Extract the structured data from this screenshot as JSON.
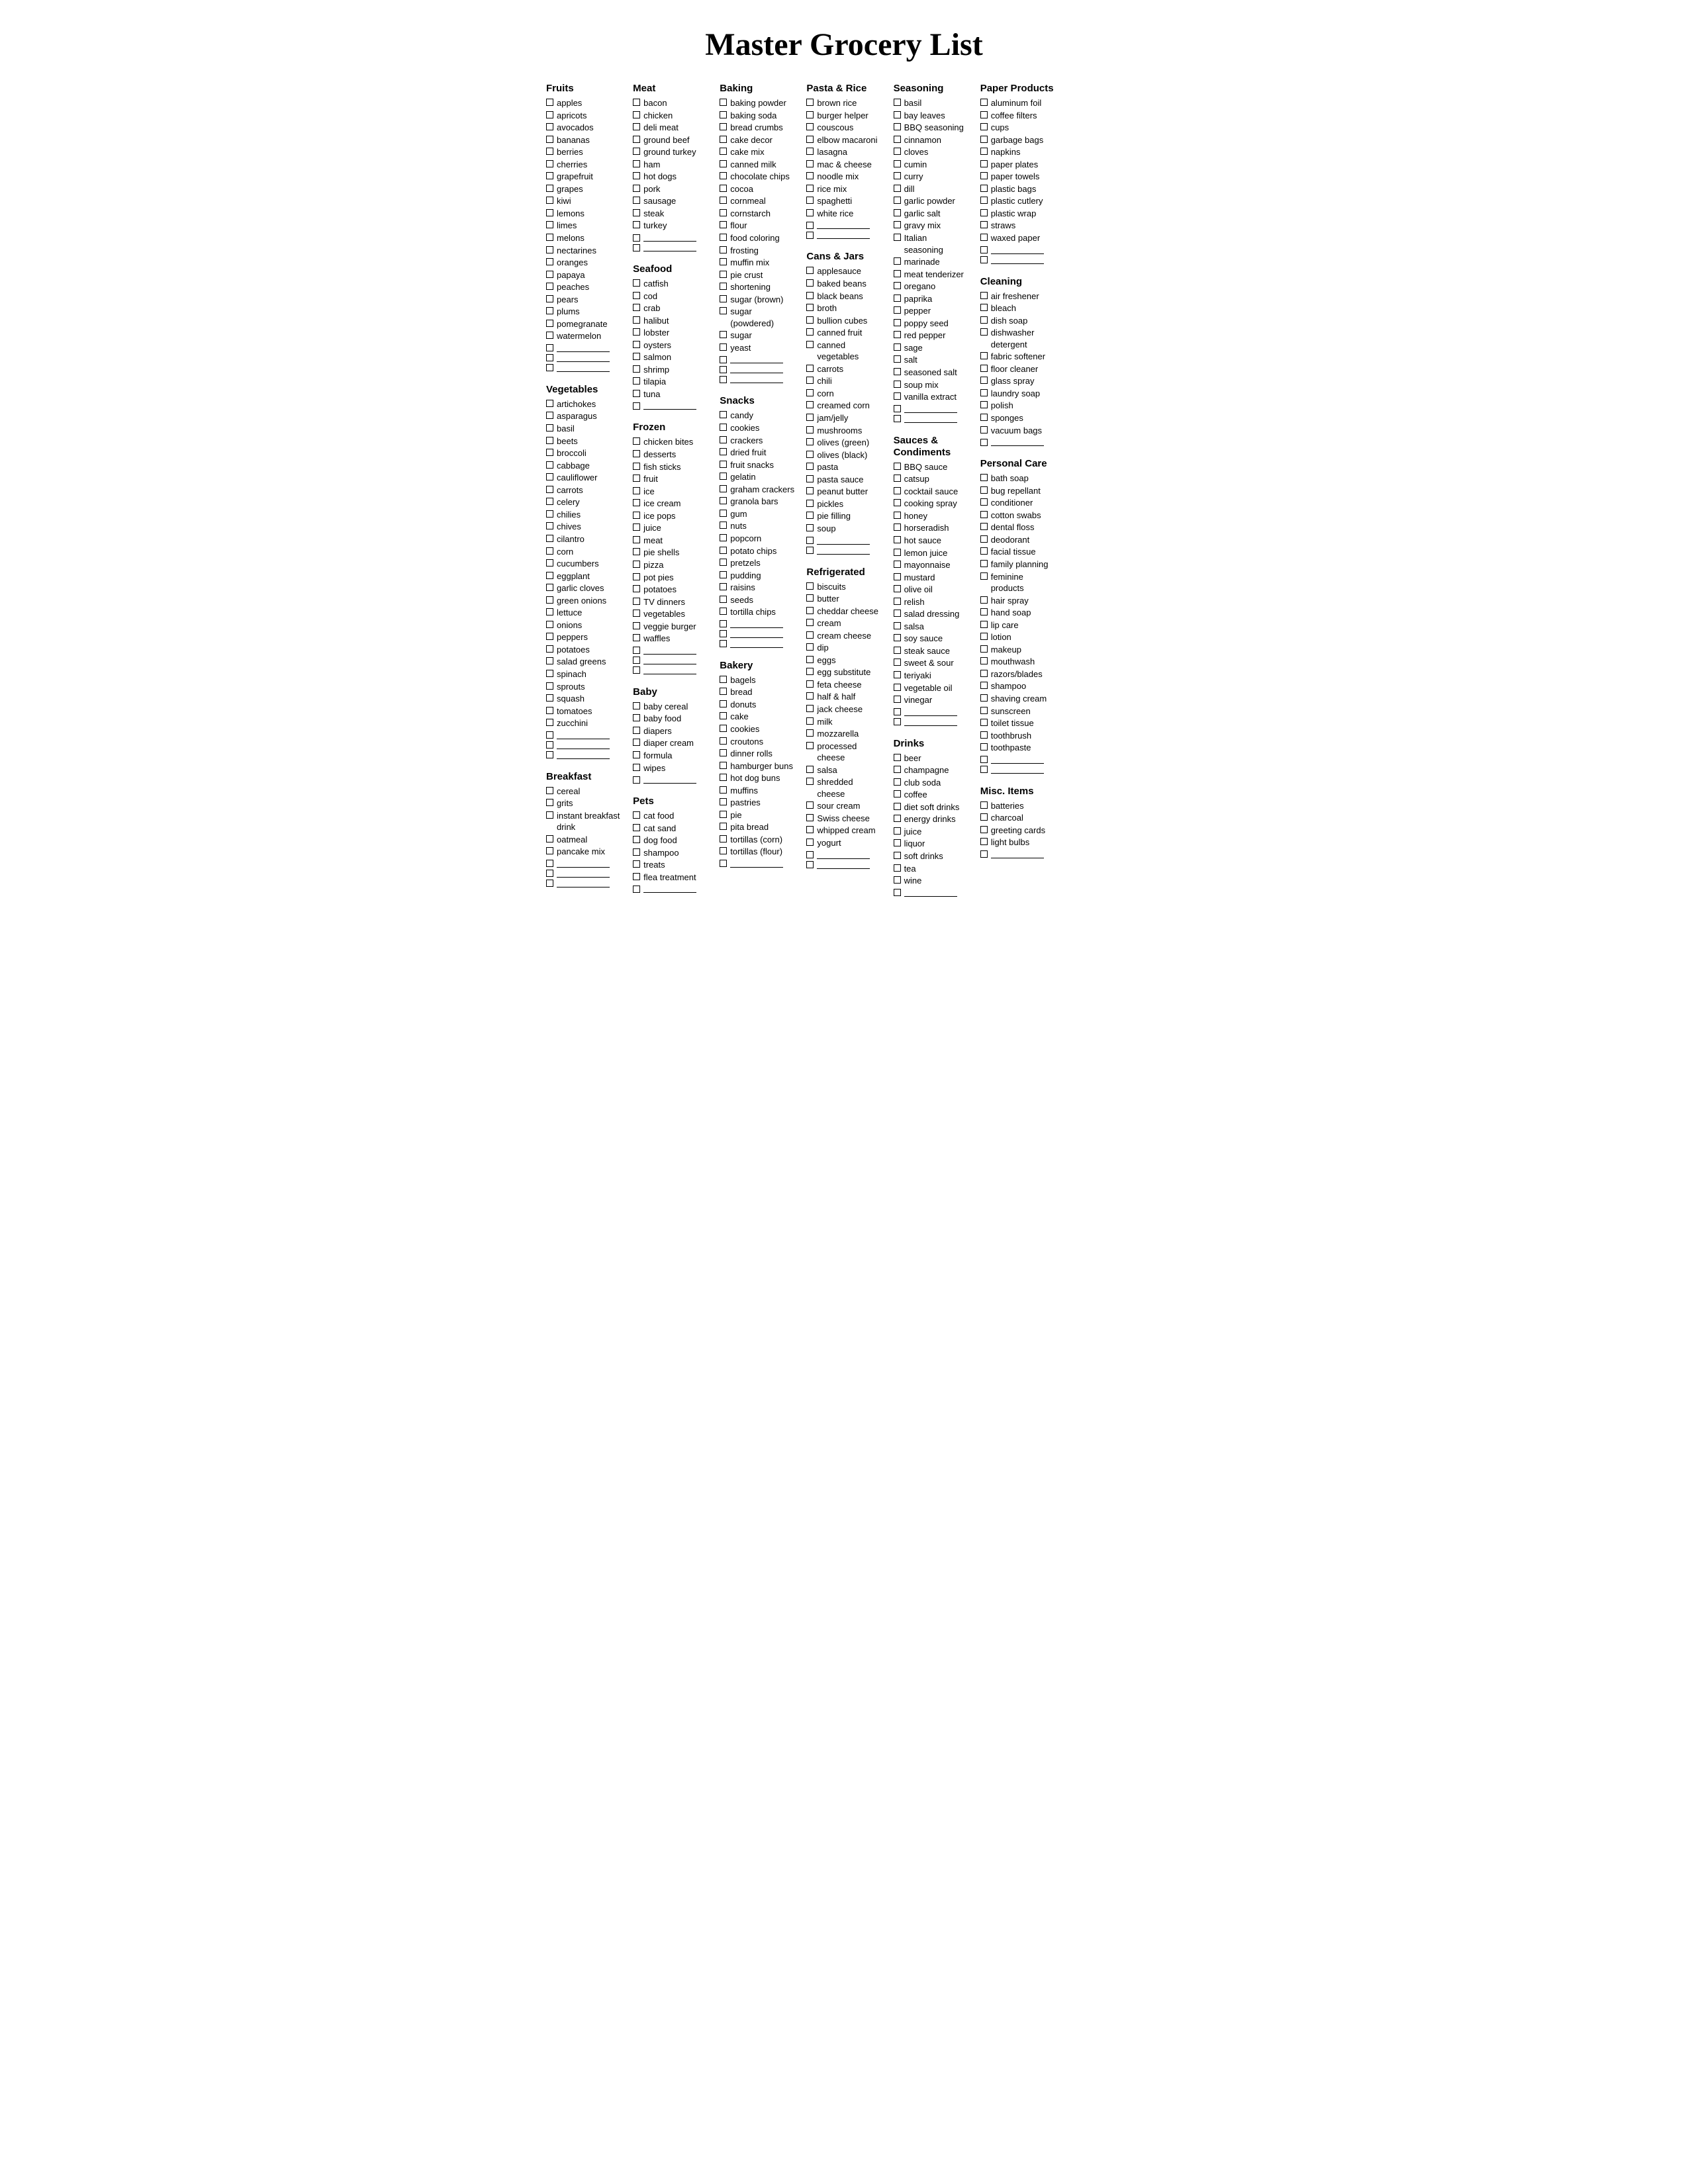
{
  "title": "Master Grocery List",
  "columns": [
    {
      "sections": [
        {
          "title": "Fruits",
          "items": [
            "apples",
            "apricots",
            "avocados",
            "bananas",
            "berries",
            "cherries",
            "grapefruit",
            "grapes",
            "kiwi",
            "lemons",
            "limes",
            "melons",
            "nectarines",
            "oranges",
            "papaya",
            "peaches",
            "pears",
            "plums",
            "pomegranate",
            "watermelon"
          ],
          "blanks": 3
        },
        {
          "title": "Vegetables",
          "items": [
            "artichokes",
            "asparagus",
            "basil",
            "beets",
            "broccoli",
            "cabbage",
            "cauliflower",
            "carrots",
            "celery",
            "chilies",
            "chives",
            "cilantro",
            "corn",
            "cucumbers",
            "eggplant",
            "garlic cloves",
            "green onions",
            "lettuce",
            "onions",
            "peppers",
            "potatoes",
            "salad greens",
            "spinach",
            "sprouts",
            "squash",
            "tomatoes",
            "zucchini"
          ],
          "blanks": 3
        },
        {
          "title": "Breakfast",
          "items": [
            "cereal",
            "grits",
            "instant breakfast drink",
            "oatmeal",
            "pancake mix"
          ],
          "blanks": 3
        }
      ]
    },
    {
      "sections": [
        {
          "title": "Meat",
          "items": [
            "bacon",
            "chicken",
            "deli meat",
            "ground beef",
            "ground turkey",
            "ham",
            "hot dogs",
            "pork",
            "sausage",
            "steak",
            "turkey"
          ],
          "blanks": 2
        },
        {
          "title": "Seafood",
          "items": [
            "catfish",
            "cod",
            "crab",
            "halibut",
            "lobster",
            "oysters",
            "salmon",
            "shrimp",
            "tilapia",
            "tuna"
          ],
          "blanks": 1
        },
        {
          "title": "Frozen",
          "items": [
            "chicken bites",
            "desserts",
            "fish sticks",
            "fruit",
            "ice",
            "ice cream",
            "ice pops",
            "juice",
            "meat",
            "pie shells",
            "pizza",
            "pot pies",
            "potatoes",
            "TV dinners",
            "vegetables",
            "veggie burger",
            "waffles"
          ],
          "blanks": 3
        },
        {
          "title": "Baby",
          "items": [
            "baby cereal",
            "baby food",
            "diapers",
            "diaper cream",
            "formula",
            "wipes"
          ],
          "blanks": 1
        },
        {
          "title": "Pets",
          "items": [
            "cat food",
            "cat sand",
            "dog food",
            "shampoo",
            "treats",
            "flea treatment"
          ],
          "blanks": 1
        }
      ]
    },
    {
      "sections": [
        {
          "title": "Baking",
          "items": [
            "baking powder",
            "baking soda",
            "bread crumbs",
            "cake decor",
            "cake mix",
            "canned milk",
            "chocolate chips",
            "cocoa",
            "cornmeal",
            "cornstarch",
            "flour",
            "food coloring",
            "frosting",
            "muffin mix",
            "pie crust",
            "shortening",
            "sugar (brown)",
            "sugar (powdered)",
            "sugar",
            "yeast"
          ],
          "blanks": 3
        },
        {
          "title": "Snacks",
          "items": [
            "candy",
            "cookies",
            "crackers",
            "dried fruit",
            "fruit snacks",
            "gelatin",
            "graham crackers",
            "granola bars",
            "gum",
            "nuts",
            "popcorn",
            "potato chips",
            "pretzels",
            "pudding",
            "raisins",
            "seeds",
            "tortilla chips"
          ],
          "blanks": 3
        },
        {
          "title": "Bakery",
          "items": [
            "bagels",
            "bread",
            "donuts",
            "cake",
            "cookies",
            "croutons",
            "dinner rolls",
            "hamburger buns",
            "hot dog buns",
            "muffins",
            "pastries",
            "pie",
            "pita bread",
            "tortillas (corn)",
            "tortillas (flour)"
          ],
          "blanks": 1
        }
      ]
    },
    {
      "sections": [
        {
          "title": "Pasta & Rice",
          "items": [
            "brown rice",
            "burger helper",
            "couscous",
            "elbow macaroni",
            "lasagna",
            "mac & cheese",
            "noodle mix",
            "rice mix",
            "spaghetti",
            "white rice"
          ],
          "blanks": 2
        },
        {
          "title": "Cans & Jars",
          "items": [
            "applesauce",
            "baked beans",
            "black beans",
            "broth",
            "bullion cubes",
            "canned fruit",
            "canned vegetables",
            "carrots",
            "chili",
            "corn",
            "creamed corn",
            "jam/jelly",
            "mushrooms",
            "olives (green)",
            "olives (black)",
            "pasta",
            "pasta sauce",
            "peanut butter",
            "pickles",
            "pie filling",
            "soup"
          ],
          "blanks": 2
        },
        {
          "title": "Refrigerated",
          "items": [
            "biscuits",
            "butter",
            "cheddar cheese",
            "cream",
            "cream cheese",
            "dip",
            "eggs",
            "egg substitute",
            "feta cheese",
            "half & half",
            "jack cheese",
            "milk",
            "mozzarella",
            "processed cheese",
            "salsa",
            "shredded cheese",
            "sour cream",
            "Swiss cheese",
            "whipped cream",
            "yogurt"
          ],
          "blanks": 2
        }
      ]
    },
    {
      "sections": [
        {
          "title": "Seasoning",
          "items": [
            "basil",
            "bay leaves",
            "BBQ seasoning",
            "cinnamon",
            "cloves",
            "cumin",
            "curry",
            "dill",
            "garlic powder",
            "garlic salt",
            "gravy mix",
            "Italian seasoning",
            "marinade",
            "meat tenderizer",
            "oregano",
            "paprika",
            "pepper",
            "poppy seed",
            "red pepper",
            "sage",
            "salt",
            "seasoned salt",
            "soup mix",
            "vanilla extract"
          ],
          "blanks": 2
        },
        {
          "title": "Sauces & Condiments",
          "items": [
            "BBQ sauce",
            "catsup",
            "cocktail sauce",
            "cooking spray",
            "honey",
            "horseradish",
            "hot sauce",
            "lemon juice",
            "mayonnaise",
            "mustard",
            "olive oil",
            "relish",
            "salad dressing",
            "salsa",
            "soy sauce",
            "steak sauce",
            "sweet & sour",
            "teriyaki",
            "vegetable oil",
            "vinegar"
          ],
          "blanks": 2
        },
        {
          "title": "Drinks",
          "items": [
            "beer",
            "champagne",
            "club soda",
            "coffee",
            "diet soft drinks",
            "energy drinks",
            "juice",
            "liquor",
            "soft drinks",
            "tea",
            "wine"
          ],
          "blanks": 1
        }
      ]
    },
    {
      "sections": [
        {
          "title": "Paper Products",
          "items": [
            "aluminum foil",
            "coffee filters",
            "cups",
            "garbage bags",
            "napkins",
            "paper plates",
            "paper towels",
            "plastic bags",
            "plastic cutlery",
            "plastic wrap",
            "straws",
            "waxed paper"
          ],
          "blanks": 2
        },
        {
          "title": "Cleaning",
          "items": [
            "air freshener",
            "bleach",
            "dish soap",
            "dishwasher detergent",
            "fabric softener",
            "floor cleaner",
            "glass spray",
            "laundry soap",
            "polish",
            "sponges",
            "vacuum bags"
          ],
          "blanks": 1
        },
        {
          "title": "Personal Care",
          "items": [
            "bath soap",
            "bug repellant",
            "conditioner",
            "cotton swabs",
            "dental floss",
            "deodorant",
            "facial tissue",
            "family planning",
            "feminine products",
            "hair spray",
            "hand soap",
            "lip care",
            "lotion",
            "makeup",
            "mouthwash",
            "razors/blades",
            "shampoo",
            "shaving cream",
            "sunscreen",
            "toilet tissue",
            "toothbrush",
            "toothpaste"
          ],
          "blanks": 2
        },
        {
          "title": "Misc. Items",
          "items": [
            "batteries",
            "charcoal",
            "greeting cards",
            "light bulbs"
          ],
          "blanks": 1
        }
      ]
    }
  ]
}
